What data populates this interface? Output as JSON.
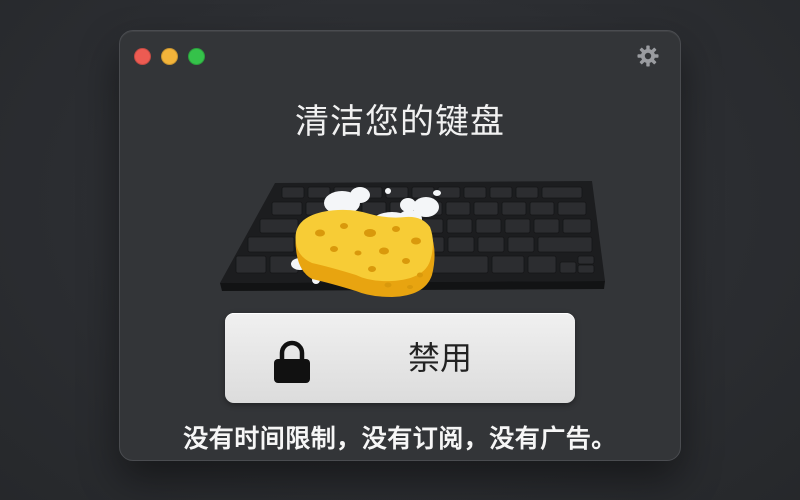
{
  "window": {
    "controls": {
      "close_color": "#ed5b52",
      "minimize_color": "#f3b43a",
      "zoom_color": "#35c24a"
    },
    "settings_icon": "gear-icon"
  },
  "header": {
    "title": "清洁您的键盘"
  },
  "illustration": {
    "icon": "keyboard-with-sponge-illustration"
  },
  "lock_button": {
    "icon": "lock-icon",
    "label": "禁用"
  },
  "footer": {
    "tagline": "没有时间限制，没有订阅，没有广告。"
  }
}
